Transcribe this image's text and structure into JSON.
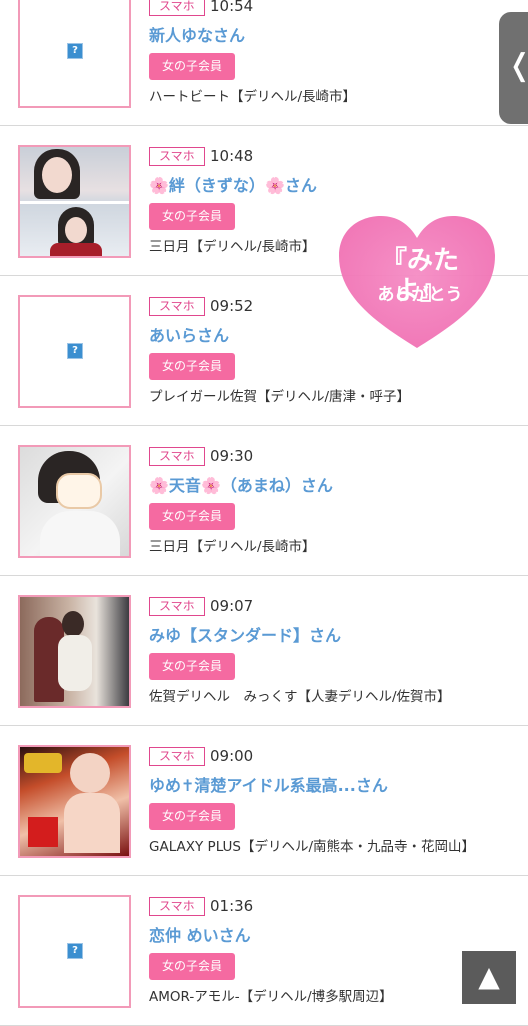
{
  "entries": [
    {
      "device": "スマホ",
      "time": "10:54",
      "name": "新人ゆなさん",
      "member": "女の子会員",
      "shop": "ハートビート【デリヘル/長崎市】",
      "thumbnail": "broken-image"
    },
    {
      "device": "スマホ",
      "time": "10:48",
      "name_flower_left": "🌸",
      "name_main": "絆（きずな）",
      "name_flower_right": "🌸",
      "name_suffix": "さん",
      "member": "女の子会員",
      "shop": "三日月【デリヘル/長崎市】",
      "thumbnail": "photo"
    },
    {
      "device": "スマホ",
      "time": "09:52",
      "name": "あいらさん",
      "member": "女の子会員",
      "shop": "プレイガール佐賀【デリヘル/唐津・呼子】",
      "thumbnail": "broken-image"
    },
    {
      "device": "スマホ",
      "time": "09:30",
      "name_flower_left": "🌸",
      "name_main": "天音",
      "name_flower_right": "🌸",
      "name_suffix": "（あまね）さん",
      "member": "女の子会員",
      "shop": "三日月【デリヘル/長崎市】",
      "thumbnail": "photo"
    },
    {
      "device": "スマホ",
      "time": "09:07",
      "name": "みゆ【スタンダード】さん",
      "member": "女の子会員",
      "shop": "佐賀デリヘル　みっくす【人妻デリヘル/佐賀市】",
      "thumbnail": "photo"
    },
    {
      "device": "スマホ",
      "time": "09:00",
      "name": "ゆめ✝清楚アイドル系最高...さん",
      "member": "女の子会員",
      "shop": "GALAXY PLUS【デリヘル/南熊本・九品寺・花岡山】",
      "thumbnail": "photo"
    },
    {
      "device": "スマホ",
      "time": "01:36",
      "name": "恋仲 めいさん",
      "member": "女の子会員",
      "shop": "AMOR-アモル-【デリヘル/博多駅周辺】",
      "thumbnail": "broken-image"
    }
  ],
  "broken_glyph": "?",
  "heart_overlay": {
    "line1": "『みたよ』",
    "line2": "ありがとう",
    "color": "#f27cb8"
  },
  "side_tab": {
    "icon": "chevron-left-icon",
    "glyph": "❬"
  },
  "scroll_top": {
    "icon": "triangle-up-icon",
    "glyph": "▲"
  },
  "colors": {
    "accent_pink": "#f56aa1",
    "name_blue": "#5a9ad4",
    "badge_pink": "#e0488e"
  }
}
